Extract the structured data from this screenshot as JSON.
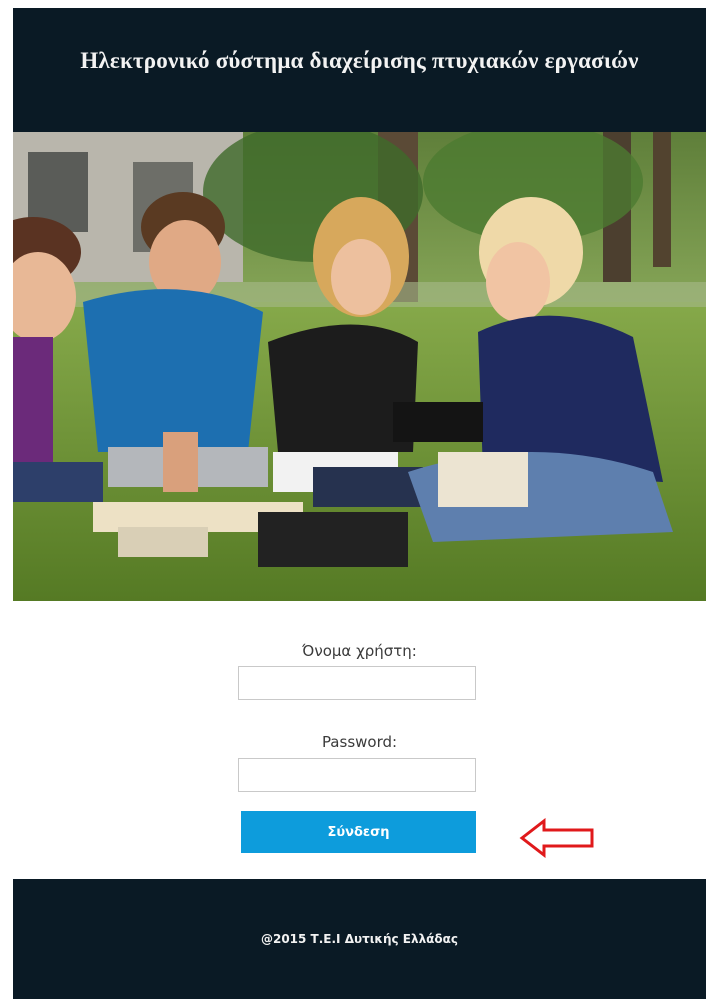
{
  "header": {
    "title": "Ηλεκτρονικό σύστημα διαχείρισης πτυχιακών εργασιών"
  },
  "hero": {
    "description_icon": "students-studying-on-grass-photo"
  },
  "login": {
    "username_label": "Όνομα χρήστη:",
    "username_value": "",
    "password_label": "Password:",
    "password_value": "",
    "submit_label": "Σύνδεση",
    "accent_color": "#0d9cdc",
    "arrow_color": "#e0191b"
  },
  "footer": {
    "copyright": "@2015 Τ.Ε.Ι Δυτικής Ελλάδας"
  }
}
